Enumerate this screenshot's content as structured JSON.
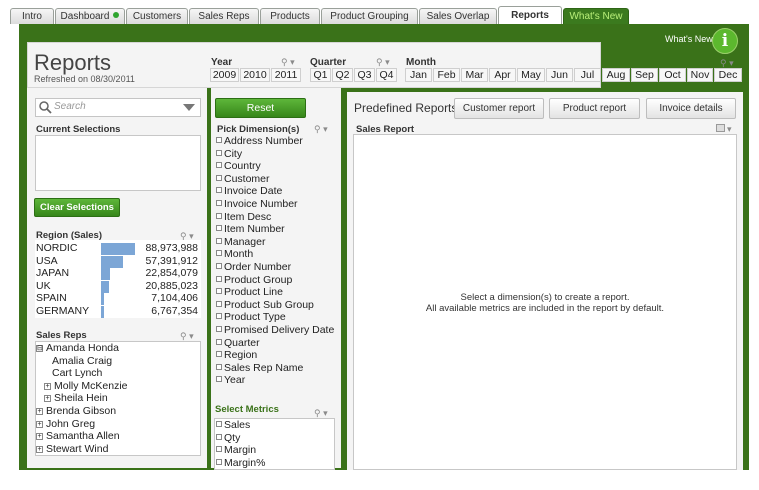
{
  "tabs": [
    {
      "label": "Intro"
    },
    {
      "label": "Dashboard"
    },
    {
      "label": "Customers"
    },
    {
      "label": "Sales Reps"
    },
    {
      "label": "Products"
    },
    {
      "label": "Product Grouping"
    },
    {
      "label": "Sales Overlap"
    },
    {
      "label": "Reports"
    },
    {
      "label": "What's New"
    }
  ],
  "header": {
    "title": "Reports",
    "refreshed": "Refreshed on 08/30/2011"
  },
  "whats_new": {
    "label": "What's New?",
    "icon_glyph": "i"
  },
  "filters": {
    "year_label": "Year",
    "years": [
      "2009",
      "2010",
      "2011"
    ],
    "quarter_label": "Quarter",
    "quarters": [
      "Q1",
      "Q2",
      "Q3",
      "Q4"
    ],
    "month_label": "Month",
    "months": [
      "Jan",
      "Feb",
      "Mar",
      "Apr",
      "May",
      "Jun",
      "Jul",
      "Aug",
      "Sep",
      "Oct",
      "Nov",
      "Dec"
    ]
  },
  "search": {
    "placeholder": "Search"
  },
  "current_selections": {
    "label": "Current Selections"
  },
  "clear_button": "Clear Selections",
  "region": {
    "label": "Region (Sales)",
    "rows": [
      {
        "name": "NORDIC",
        "value": "88,973,988",
        "amount": 88973988
      },
      {
        "name": "USA",
        "value": "57,391,912",
        "amount": 57391912
      },
      {
        "name": "JAPAN",
        "value": "22,854,079",
        "amount": 22854079
      },
      {
        "name": "UK",
        "value": "20,885,023",
        "amount": 20885023
      },
      {
        "name": "SPAIN",
        "value": "7,104,406",
        "amount": 7104406
      },
      {
        "name": "GERMANY",
        "value": "6,767,354",
        "amount": 6767354
      }
    ]
  },
  "sales_reps": {
    "label": "Sales Reps",
    "items": [
      {
        "name": "Amanda Honda",
        "expander": "⊟"
      },
      {
        "name": "Amalia Craig",
        "expander": ""
      },
      {
        "name": "Cart Lynch",
        "expander": ""
      },
      {
        "name": "Molly McKenzie",
        "expander": "+"
      },
      {
        "name": "Sheila Hein",
        "expander": "+"
      },
      {
        "name": "Brenda Gibson",
        "expander": "+"
      },
      {
        "name": "John Greg",
        "expander": "+"
      },
      {
        "name": "Samantha Allen",
        "expander": "+"
      },
      {
        "name": "Stewart Wind",
        "expander": "+"
      }
    ]
  },
  "reset_button": "Reset",
  "dimensions": {
    "label": "Pick Dimension(s)",
    "items": [
      "Address Number",
      "City",
      "Country",
      "Customer",
      "Invoice Date",
      "Invoice Number",
      "Item Desc",
      "Item Number",
      "Manager",
      "Month",
      "Order Number",
      "Product Group",
      "Product Line",
      "Product Sub Group",
      "Product Type",
      "Promised Delivery Date",
      "Quarter",
      "Region",
      "Sales Rep Name",
      "Year"
    ]
  },
  "metrics": {
    "label": "Select Metrics",
    "items": [
      "Sales",
      "Qty",
      "Margin",
      "Margin%"
    ]
  },
  "predefined": {
    "label": "Predefined Reports:",
    "buttons": [
      "Customer report",
      "Product report",
      "Invoice details"
    ]
  },
  "sales_report": {
    "label": "Sales Report",
    "message_line1": "Select a dimension(s) to create a report.",
    "message_line2": "All available metrics are included in the report by default."
  },
  "colors": {
    "frame_green": "#3a7219",
    "button_green": "#36861a",
    "bar_blue": "#7ca6d6"
  }
}
